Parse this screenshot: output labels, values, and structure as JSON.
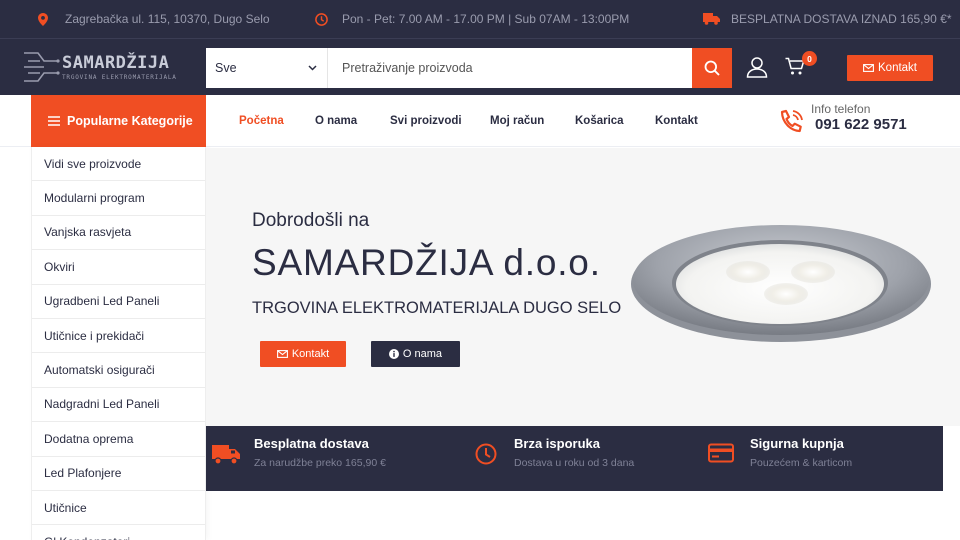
{
  "topbar": {
    "address": "Zagrebačka ul. 115, 10370, Dugo Selo",
    "hours": "Pon - Pet: 7.00 AM - 17.00 PM | Sub 07AM - 13:00PM",
    "shipping": "BESPLATNA DOSTAVA IZNAD 165,90 €*"
  },
  "logo": {
    "title": "SAMARDŽIJA",
    "subtitle": "TRGOVINA ELEKTROMATERIJALA"
  },
  "search": {
    "category": "Sve",
    "placeholder": "Pretraživanje proizvoda"
  },
  "header": {
    "cart_count": "0",
    "contact_label": "Kontakt"
  },
  "nav": {
    "categories_label": "Popularne Kategorije",
    "links": [
      "Početna",
      "O nama",
      "Svi proizvodi",
      "Moj račun",
      "Košarica",
      "Kontakt"
    ],
    "phone_label": "Info telefon",
    "phone_number": "091 622 9571"
  },
  "sidebar": {
    "items": [
      "Vidi sve proizvode",
      "Modularni program",
      "Vanjska rasvjeta",
      "Okviri",
      "Ugradbeni Led Paneli",
      "Utičnice i prekidači",
      "Automatski osigurači",
      "Nadgradni Led Paneli",
      "Dodatna oprema",
      "Led Plafonjere",
      "Utičnice",
      "Gl Kondenzatori"
    ]
  },
  "hero": {
    "welcome": "Dobrodošli na",
    "title": "SAMARDŽIJA d.o.o.",
    "subtitle": "TRGOVINA ELEKTROMATERIJALA DUGO SELO",
    "btn_contact": "Kontakt",
    "btn_about": "O nama"
  },
  "features": [
    {
      "icon": "truck-icon",
      "title": "Besplatna dostava",
      "desc": "Za narudžbe preko 165,90 €"
    },
    {
      "icon": "clock-icon",
      "title": "Brza isporuka",
      "desc": "Dostava u roku od 3 dana"
    },
    {
      "icon": "credit-card-icon",
      "title": "Sigurna kupnja",
      "desc": "Pouzećem & karticom"
    }
  ],
  "colors": {
    "accent": "#f04e23",
    "dark": "#2b2d42"
  }
}
